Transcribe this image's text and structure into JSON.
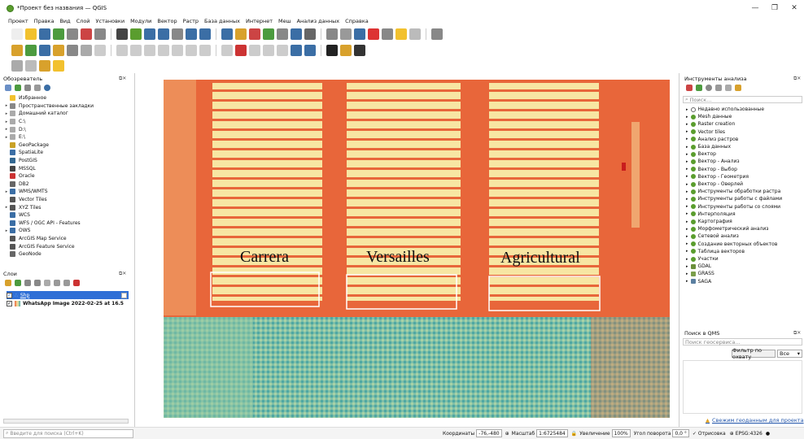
{
  "window": {
    "title": "*Проект без названия — QGIS"
  },
  "menu": [
    "Проект",
    "Правка",
    "Вид",
    "Слой",
    "Установки",
    "Модули",
    "Вектор",
    "Растр",
    "База данных",
    "Интернет",
    "Меш",
    "Анализ данных",
    "Справка"
  ],
  "browser": {
    "title": "Обозреватель",
    "items": [
      {
        "label": "Избранное",
        "arrow": "",
        "color": "#f2c12e"
      },
      {
        "label": "Пространственные закладки",
        "arrow": "▸",
        "color": "#888"
      },
      {
        "label": "Домашний каталог",
        "arrow": "▸",
        "color": "#aaa"
      },
      {
        "label": "C:\\",
        "arrow": "▸",
        "color": "#aaa"
      },
      {
        "label": "D:\\",
        "arrow": "▸",
        "color": "#aaa"
      },
      {
        "label": "E:\\",
        "arrow": "▸",
        "color": "#aaa"
      },
      {
        "label": "GeoPackage",
        "arrow": "",
        "color": "#c9a227"
      },
      {
        "label": "SpatiaLite",
        "arrow": "",
        "color": "#3b6ea5"
      },
      {
        "label": "PostGIS",
        "arrow": "",
        "color": "#336791"
      },
      {
        "label": "MSSQL",
        "arrow": "",
        "color": "#444"
      },
      {
        "label": "Oracle",
        "arrow": "",
        "color": "#c33"
      },
      {
        "label": "DB2",
        "arrow": "",
        "color": "#666"
      },
      {
        "label": "WMS/WMTS",
        "arrow": "▸",
        "color": "#3b6ea5"
      },
      {
        "label": "Vector Tiles",
        "arrow": "",
        "color": "#555"
      },
      {
        "label": "XYZ Tiles",
        "arrow": "▸",
        "color": "#555"
      },
      {
        "label": "WCS",
        "arrow": "",
        "color": "#3b6ea5"
      },
      {
        "label": "WFS / OGC API - Features",
        "arrow": "",
        "color": "#3b6ea5"
      },
      {
        "label": "OWS",
        "arrow": "▸",
        "color": "#3b6ea5"
      },
      {
        "label": "ArcGIS Map Service",
        "arrow": "",
        "color": "#555"
      },
      {
        "label": "ArcGIS Feature Service",
        "arrow": "",
        "color": "#555"
      },
      {
        "label": "GeoNode",
        "arrow": "",
        "color": "#666"
      }
    ]
  },
  "layers": {
    "title": "Слои",
    "items": [
      {
        "label": "Shp",
        "checked": "✓",
        "selected": true
      },
      {
        "label": "WhatsApp Image 2022-02-25 at 16.5",
        "checked": "✓",
        "selected": false
      }
    ]
  },
  "map": {
    "labels": [
      "Carrera",
      "Versailles",
      "Agricultural"
    ],
    "colors": {
      "background": "#e8663a",
      "light": "#f7e6a3",
      "teal": "#4fa8a3",
      "mid": "#f3b873"
    }
  },
  "toolbox": {
    "title": "Инструменты анализа",
    "search_placeholder": "Поиск...",
    "items": [
      "Недавно использованные",
      "Mesh данные",
      "Raster creation",
      "Vector tiles",
      "Анализ растров",
      "База данных",
      "Вектор",
      "Вектор - Анализ",
      "Вектор - Выбор",
      "Вектор - Геометрия",
      "Вектор - Оверлей",
      "Инструменты обработки растра",
      "Инструменты работы с файлами",
      "Инструменты работы со слоями",
      "Интерполяция",
      "Картография",
      "Морфометрический анализ",
      "Сетевой анализ",
      "Создание векторных объектов",
      "Таблица векторов",
      "Участки",
      "GDAL",
      "GRASS",
      "SAGA"
    ]
  },
  "qms": {
    "title": "Поиск в QMS",
    "search_placeholder": "Поиск геосервиса...",
    "filter_button": "Фильтр по охвату",
    "filter_select": "Все",
    "link": "Свежим геоданным для проекта"
  },
  "status": {
    "search_placeholder": "Введите для поиска (Ctrl+K)",
    "coord_label": "Координаты",
    "coord_value": "-76,-480",
    "scale_label": "Масштаб",
    "scale_value": "1:6725484",
    "zoom_label": "Увеличение",
    "zoom_value": "100%",
    "rotation_label": "Угол поворота",
    "rotation_value": "0,0 °",
    "render_label": "Отрисовка",
    "crs": "EPSG:4326"
  }
}
